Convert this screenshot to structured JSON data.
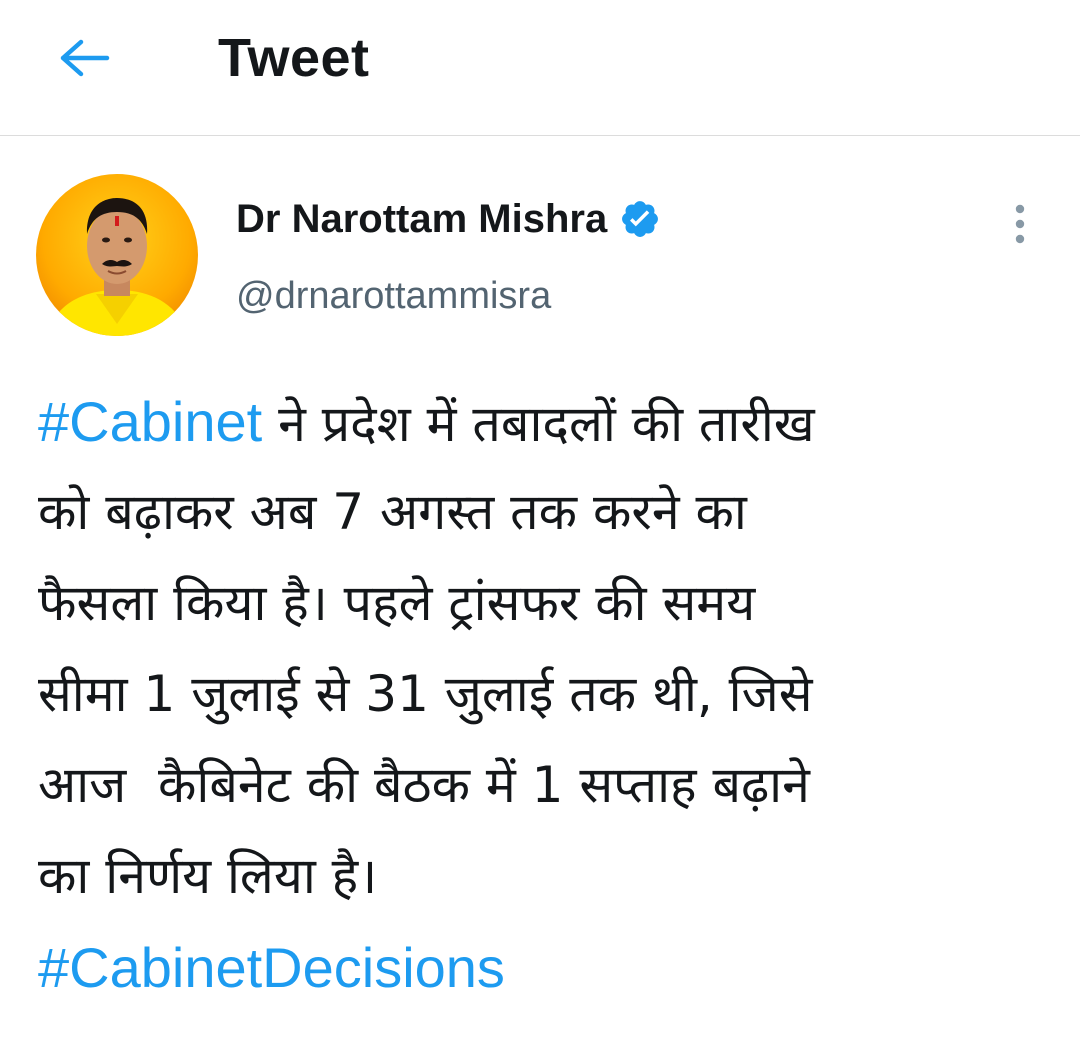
{
  "header": {
    "title": "Tweet",
    "back_icon": "arrow-left-icon"
  },
  "author": {
    "name": "Dr Narottam Mishra",
    "handle": "@drnarottammisra",
    "verified_icon": "verified-badge-icon",
    "avatar_description": "profile photo"
  },
  "more_icon": "more-vertical-icon",
  "tweet": {
    "hashtag_1": "#Cabinet",
    "line_1_rest": " ने प्रदेश में तबादलों की तारीख",
    "line_2": "को बढ़ाकर अब 7 अगस्त तक करने का",
    "line_3": "फैसला किया है। पहले ट्रांसफर की समय",
    "line_4": "सीमा 1 जुलाई से 31 जुलाई तक थी, जिसे",
    "line_5": "आज  कैबिनेट की बैठक में 1 सप्ताह बढ़ाने",
    "line_6": "का निर्णय लिया है।",
    "hashtag_2": "#CabinetDecisions"
  },
  "colors": {
    "accent": "#1d9bf0",
    "text": "#14171a",
    "secondary_text": "#536471",
    "divider": "#dcdcdc"
  }
}
